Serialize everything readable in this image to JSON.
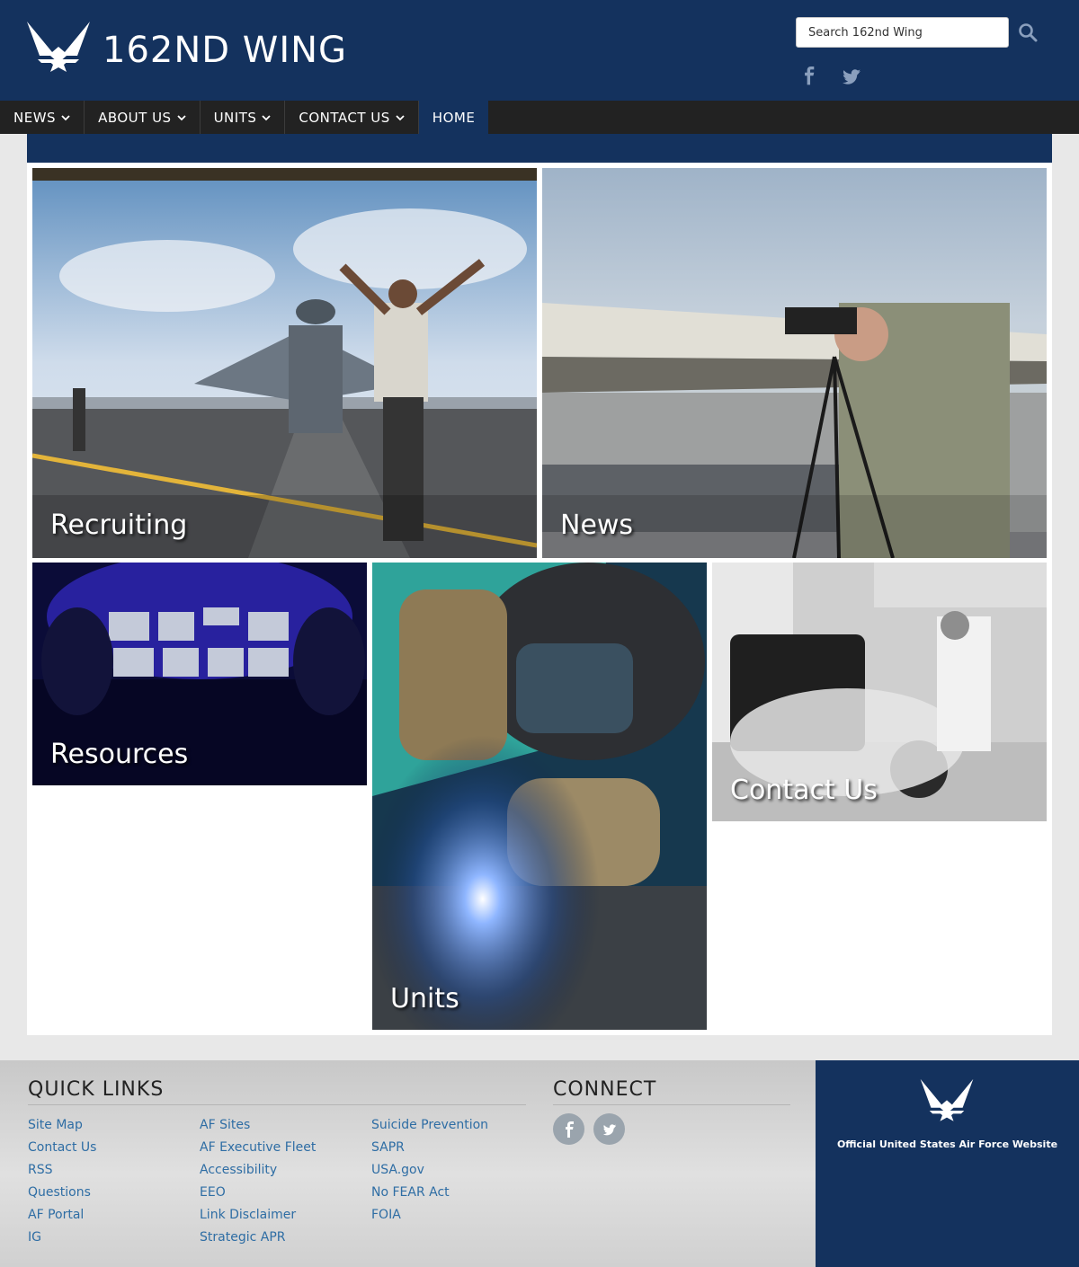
{
  "header": {
    "title": "162ND WING",
    "search_placeholder": "Search 162nd Wing",
    "social": [
      "facebook-icon",
      "twitter-icon"
    ]
  },
  "nav": {
    "items": [
      {
        "label": "NEWS",
        "has_dropdown": true
      },
      {
        "label": "ABOUT US",
        "has_dropdown": true
      },
      {
        "label": "UNITS",
        "has_dropdown": true
      },
      {
        "label": "CONTACT US",
        "has_dropdown": true
      },
      {
        "label": "HOME",
        "has_dropdown": false,
        "active": true
      }
    ]
  },
  "tiles": {
    "recruiting": "Recruiting",
    "news": "News",
    "resources": "Resources",
    "units": "Units",
    "contact": "Contact Us"
  },
  "footer": {
    "quick_links_heading": "QUICK LINKS",
    "quick_links": {
      "col1": [
        "Site Map",
        "Contact Us",
        "RSS",
        "Questions",
        "AF Portal",
        "IG"
      ],
      "col2": [
        "AF Sites",
        "AF Executive Fleet",
        "Accessibility",
        "EEO",
        "Link Disclaimer",
        "Strategic APR"
      ],
      "col3": [
        "Suicide Prevention",
        "SAPR",
        "USA.gov",
        "No FEAR Act",
        "FOIA"
      ]
    },
    "connect_heading": "CONNECT",
    "connect_icons": [
      "facebook-icon",
      "twitter-icon"
    ],
    "af_text": "Official United States Air Force Website"
  },
  "colors": {
    "brand_navy": "#14325e",
    "nav_bg": "#222222",
    "link": "#2e6da4"
  }
}
